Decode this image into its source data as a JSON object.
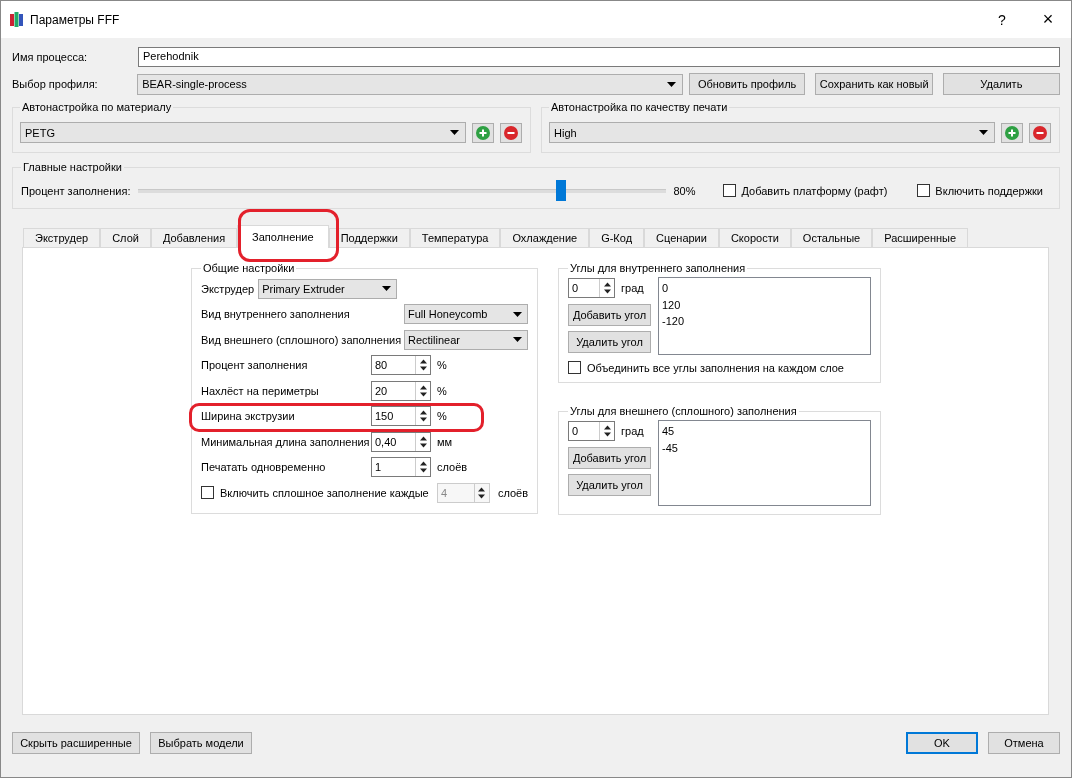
{
  "window": {
    "title": "Параметры FFF",
    "help": "?",
    "close": "×"
  },
  "process_name": {
    "label": "Имя процесса:",
    "value": "Perehodnik"
  },
  "profile": {
    "label": "Выбор профиля:",
    "value": "BEAR-single-process",
    "buttons": [
      "Обновить профиль",
      "Сохранить как новый",
      "Удалить"
    ]
  },
  "auto_groups": [
    {
      "title": "Автонастройка по  материалу",
      "value": "PETG"
    },
    {
      "title": "Автонастройка по качеству печати",
      "value": "High"
    }
  ],
  "main_settings": {
    "title": "Главные настройки",
    "slider_label": "Процент заполнения:",
    "level": 0.8,
    "reading": "80%",
    "checkboxes": [
      {
        "label": "Добавить платформу (рафт)",
        "checked": false
      },
      {
        "label": "Включить поддержки",
        "checked": false
      }
    ]
  },
  "tabs": [
    {
      "label": "Экструдер",
      "selected": false,
      "circled": false
    },
    {
      "label": "Слой",
      "selected": false,
      "circled": false
    },
    {
      "label": "Добавления",
      "selected": false,
      "circled": false
    },
    {
      "label": "Заполнение",
      "selected": true,
      "circled": true
    },
    {
      "label": "Поддержки",
      "selected": false,
      "circled": false
    },
    {
      "label": "Температура",
      "selected": false,
      "circled": false
    },
    {
      "label": "Охлаждение",
      "selected": false,
      "circled": false
    },
    {
      "label": "G-Код",
      "selected": false,
      "circled": false
    },
    {
      "label": "Сценарии",
      "selected": false,
      "circled": false
    },
    {
      "label": "Скорости",
      "selected": false,
      "circled": false
    },
    {
      "label": "Остальные",
      "selected": false,
      "circled": false
    },
    {
      "label": "Расширенные",
      "selected": false,
      "circled": false
    }
  ],
  "general": {
    "title": "Общие настройки",
    "rows": [
      {
        "kind": "picker",
        "label": "Экструдер",
        "value": "Primary Extruder",
        "circled": false
      },
      {
        "kind": "combo",
        "label": "Вид внутреннего заполнения",
        "value": "Full Honeycomb",
        "circled": false
      },
      {
        "kind": "combo",
        "label": "Вид внешнего (сплошного) заполнения",
        "value": "Rectilinear",
        "circled": false
      },
      {
        "kind": "spin",
        "label": "Процент заполнения",
        "value": "80",
        "unit": "%",
        "circled": false
      },
      {
        "kind": "spin",
        "label": "Нахлёст на периметры",
        "value": "20",
        "unit": "%",
        "circled": false
      },
      {
        "kind": "spin",
        "label": "Ширина экструзии",
        "value": "150",
        "unit": "%",
        "circled": true
      },
      {
        "kind": "spin",
        "label": "Минимальная длина заполнения",
        "value": "0,40",
        "unit": "мм",
        "circled": false
      },
      {
        "kind": "spin",
        "label": "Печатать одновременно",
        "value": "1",
        "unit": "слоёв",
        "circled": false
      },
      {
        "kind": "check",
        "label": "Включить сплошное заполнение каждые",
        "checked": false,
        "value": "4",
        "disabled": true,
        "unit": "слоёв",
        "circled": false
      }
    ]
  },
  "angle_groups": [
    {
      "title": "Углы для внутреннего заполнения",
      "value": "0",
      "unit": "град",
      "buttons": [
        "Добавить угол",
        "Удалить угол"
      ],
      "angles": [
        "0",
        "120",
        "-120"
      ],
      "checkbox": {
        "label": "Объединить все углы заполнения на каждом слое",
        "checked": false
      }
    },
    {
      "title": "Углы для внешнего (сплошного) заполнения",
      "value": "0",
      "unit": "град",
      "buttons": [
        "Добавить угол",
        "Удалить угол"
      ],
      "angles": [
        "45",
        "-45"
      ]
    }
  ],
  "footer": {
    "left": [
      "Скрыть расширенные",
      "Выбрать модели"
    ],
    "right": [
      {
        "label": "OK",
        "default": true
      },
      {
        "label": "Отмена",
        "default": false
      }
    ]
  }
}
